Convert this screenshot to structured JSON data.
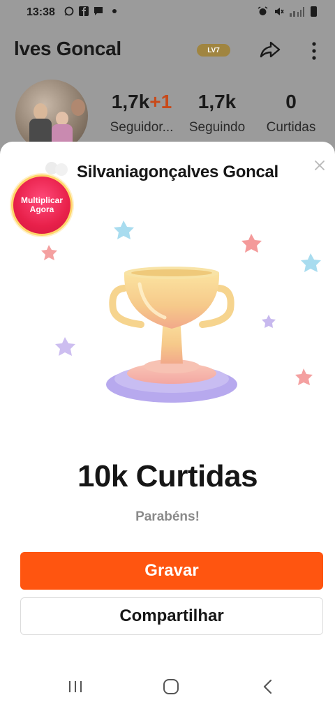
{
  "status_bar": {
    "time": "13:38",
    "left_icons": [
      "whatsapp-icon",
      "facebook-icon",
      "message-icon"
    ],
    "right_icons": [
      "alarm-icon",
      "mute-icon",
      "signal-icon",
      "battery-icon"
    ]
  },
  "profile": {
    "name_truncated": "lves Goncal",
    "level_badge": "LV7",
    "stats": [
      {
        "value": "1,7k",
        "delta": "+1",
        "label": "Seguidor..."
      },
      {
        "value": "1,7k",
        "delta": "",
        "label": "Seguindo"
      },
      {
        "value": "0",
        "delta": "",
        "label": "Curtidas"
      }
    ]
  },
  "sheet": {
    "user_name": "Silvaniagonçalves Goncal",
    "promo_badge_line1": "Multiplicar",
    "promo_badge_line2": "Agora",
    "headline": "10k Curtidas",
    "subline": "Parabéns!",
    "primary_button": "Gravar",
    "secondary_button": "Compartilhar"
  },
  "colors": {
    "accent_orange": "#ff5510",
    "plus_red": "#c84a1a",
    "dim_background": "#9b9b9b"
  }
}
